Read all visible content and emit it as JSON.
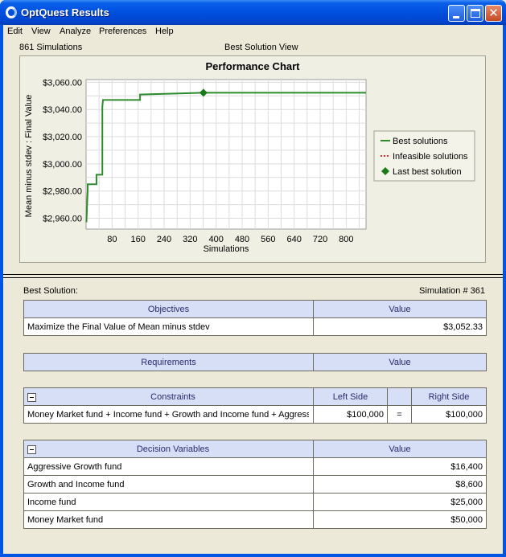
{
  "window": {
    "title": "OptQuest Results"
  },
  "menu": [
    "Edit",
    "View",
    "Analyze",
    "Preferences",
    "Help"
  ],
  "header": {
    "simulations_label": "861 Simulations",
    "view_label": "Best Solution View"
  },
  "chart_data": {
    "type": "line",
    "title": "Performance Chart",
    "xlabel": "Simulations",
    "ylabel": "Mean minus stdev : Final Value",
    "xlim": [
      0,
      861
    ],
    "ylim": [
      2952,
      3062
    ],
    "x_ticks": [
      80,
      160,
      240,
      320,
      400,
      480,
      560,
      640,
      720,
      800
    ],
    "y_ticks": [
      2960,
      2980,
      3000,
      3020,
      3040,
      3060
    ],
    "y_tick_labels": [
      "$2,960.00",
      "$2,980.00",
      "$3,000.00",
      "$3,020.00",
      "$3,040.00",
      "$3,060.00"
    ],
    "grid": true,
    "legend_position": "right",
    "series": [
      {
        "name": "Best solutions",
        "color": "#2e8b2e",
        "style": "solid",
        "x": [
          1,
          5,
          5,
          32,
          32,
          50,
          50,
          52,
          52,
          166,
          166,
          361,
          861
        ],
        "y": [
          2957,
          2981,
          2985,
          2985,
          2992,
          2992,
          3042,
          3047,
          3047,
          3047,
          3051,
          3052.33,
          3052.33
        ]
      },
      {
        "name": "Infeasible solutions",
        "color": "#e03030",
        "style": "dotted",
        "x": [],
        "y": []
      },
      {
        "name": "Last best solution",
        "color": "#1a7a1a",
        "style": "diamond-marker",
        "x": [
          361
        ],
        "y": [
          3052.33
        ]
      }
    ]
  },
  "best_solution": {
    "label": "Best Solution:",
    "simulation": "Simulation # 361"
  },
  "objectives": {
    "header": "Objectives",
    "value_header": "Value",
    "rows": [
      {
        "name": "Maximize the Final Value of Mean minus stdev",
        "value": "$3,052.33"
      }
    ]
  },
  "requirements": {
    "header": "Requirements",
    "value_header": "Value"
  },
  "constraints": {
    "header": "Constraints",
    "left_header": "Left Side",
    "right_header": "Right Side",
    "rows": [
      {
        "name": "Money Market fund + Income fund + Growth and Income fund + Aggress...",
        "left": "$100,000",
        "op": "=",
        "right": "$100,000"
      }
    ]
  },
  "decision_variables": {
    "header": "Decision Variables",
    "value_header": "Value",
    "rows": [
      {
        "name": "Aggressive Growth fund",
        "value": "$16,400"
      },
      {
        "name": "Growth and Income fund",
        "value": "$8,600"
      },
      {
        "name": "Income fund",
        "value": "$25,000"
      },
      {
        "name": "Money Market fund",
        "value": "$50,000"
      }
    ]
  }
}
